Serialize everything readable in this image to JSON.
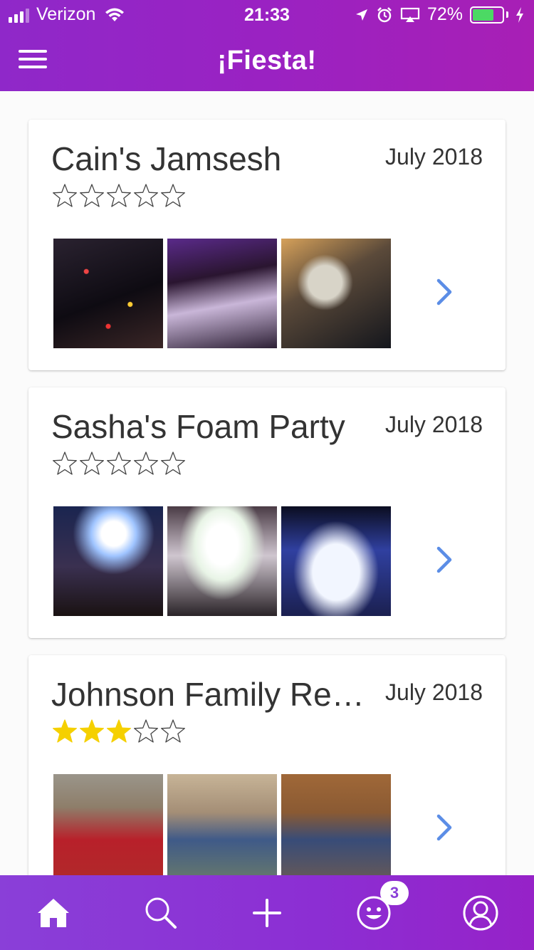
{
  "status_bar": {
    "carrier": "Verizon",
    "time": "21:33",
    "battery_percent": "72%",
    "signal_bars": 4,
    "signal_filled": 3
  },
  "header": {
    "title": "¡Fiesta!",
    "background_start": "#8f28c9",
    "background_end": "#a81fb5"
  },
  "events": [
    {
      "title": "Cain's Jamsesh",
      "date": "July 2018",
      "rating": 0,
      "max_rating": 5,
      "photos": [
        "confetti-party",
        "club-crowd",
        "confetti-crowd"
      ]
    },
    {
      "title": "Sasha's Foam Party",
      "date": "July 2018",
      "rating": 0,
      "max_rating": 5,
      "photos": [
        "foam-cannon",
        "foam-crowd",
        "foam-dancers"
      ]
    },
    {
      "title": "Johnson Family Reu...",
      "date": "July 2018",
      "rating": 3,
      "max_rating": 5,
      "photos": [
        "family-tshirts",
        "family-portrait",
        "family-group"
      ]
    }
  ],
  "tabbar": {
    "tabs": [
      {
        "name": "home",
        "icon": "home-icon",
        "active": true
      },
      {
        "name": "search",
        "icon": "search-icon",
        "active": false
      },
      {
        "name": "add",
        "icon": "plus-icon",
        "active": false
      },
      {
        "name": "notifications",
        "icon": "smiley-icon",
        "active": false,
        "badge": "3"
      },
      {
        "name": "profile",
        "icon": "user-icon",
        "active": false
      }
    ],
    "background": "#8a3fd8"
  },
  "colors": {
    "star_filled": "#f5d000",
    "chevron": "#5b8de6"
  }
}
